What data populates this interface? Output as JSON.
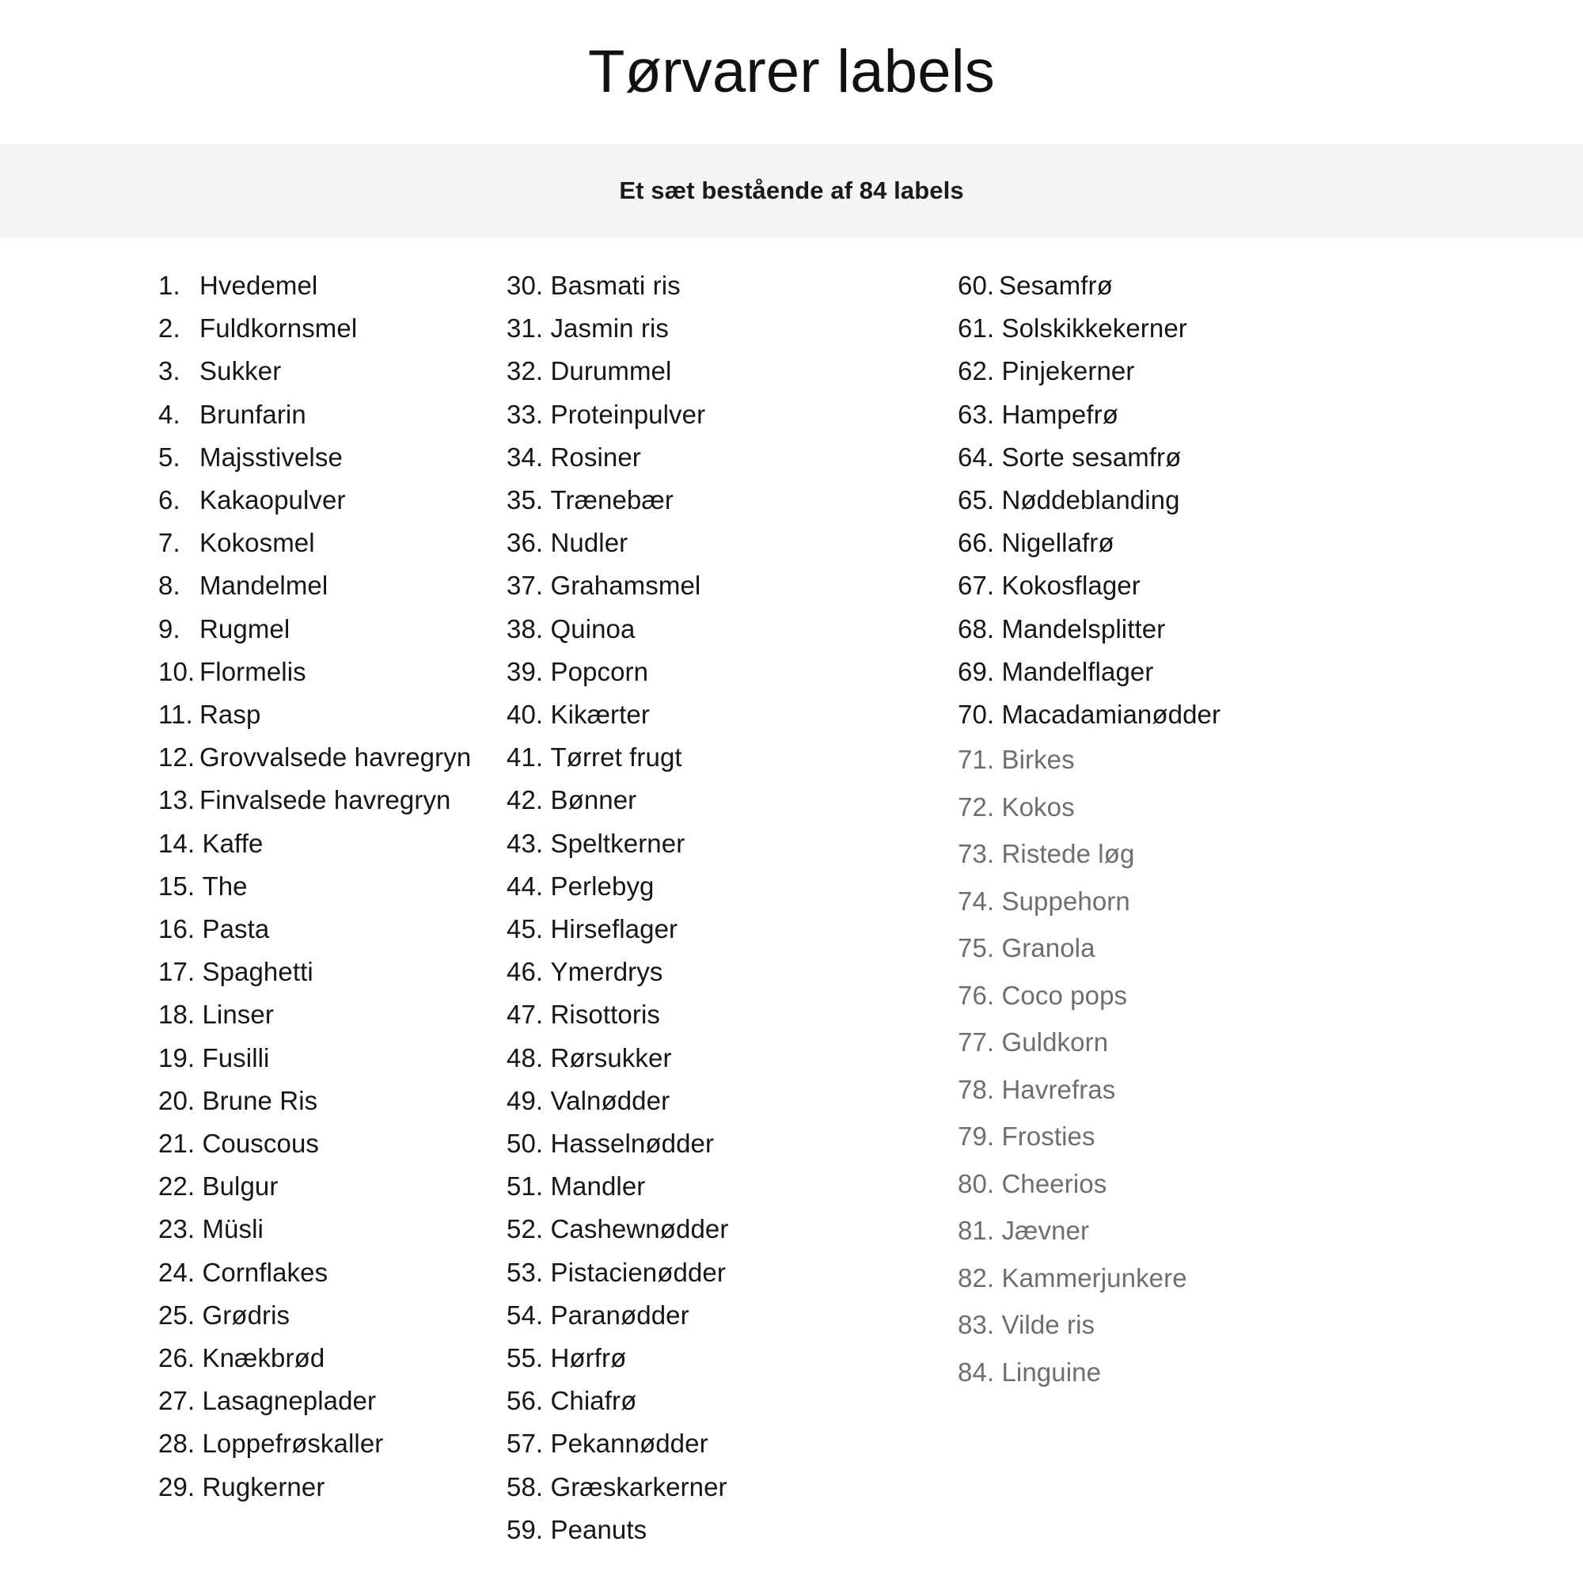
{
  "header": {
    "title": "Tørvarer labels",
    "subtitle": "Et sæt bestående af 84 labels",
    "subtitle_band_color": "#f5f5f5",
    "title_color": "#111111",
    "text_color": "#161616",
    "muted_text_color": "#6e6e6e",
    "background_color": "#ffffff"
  },
  "columns": [
    {
      "id": "column-1",
      "items": [
        {
          "num": "1.",
          "label": "Hvedemel",
          "spaced": true,
          "muted": false
        },
        {
          "num": "2.",
          "label": "Fuldkornsmel",
          "spaced": true,
          "muted": false
        },
        {
          "num": "3.",
          "label": "Sukker",
          "spaced": true,
          "muted": false
        },
        {
          "num": "4.",
          "label": "Brunfarin",
          "spaced": true,
          "muted": false
        },
        {
          "num": "5.",
          "label": "Majsstivelse",
          "spaced": true,
          "muted": false
        },
        {
          "num": "6.",
          "label": "Kakaopulver",
          "spaced": true,
          "muted": false
        },
        {
          "num": "7.",
          "label": "Kokosmel",
          "spaced": true,
          "muted": false
        },
        {
          "num": "8.",
          "label": "Mandelmel",
          "spaced": true,
          "muted": false
        },
        {
          "num": "9.",
          "label": "Rugmel",
          "spaced": true,
          "muted": false
        },
        {
          "num": "10.",
          "label": "Flormelis",
          "spaced": false,
          "muted": false
        },
        {
          "num": "11.",
          "label": "Rasp",
          "spaced": false,
          "muted": false
        },
        {
          "num": "12.",
          "label": "Grovvalsede havregryn",
          "spaced": false,
          "muted": false
        },
        {
          "num": "13.",
          "label": "Finvalsede havregryn",
          "spaced": false,
          "muted": false
        },
        {
          "num": "14.",
          "label": "Kaffe",
          "spaced": true,
          "muted": false
        },
        {
          "num": "15.",
          "label": "The",
          "spaced": true,
          "muted": false
        },
        {
          "num": "16.",
          "label": "Pasta",
          "spaced": true,
          "muted": false
        },
        {
          "num": "17.",
          "label": "Spaghetti",
          "spaced": true,
          "muted": false
        },
        {
          "num": "18.",
          "label": "Linser",
          "spaced": true,
          "muted": false
        },
        {
          "num": "19.",
          "label": "Fusilli",
          "spaced": true,
          "muted": false
        },
        {
          "num": "20.",
          "label": "Brune Ris",
          "spaced": true,
          "muted": false
        },
        {
          "num": "21.",
          "label": "Couscous",
          "spaced": true,
          "muted": false
        },
        {
          "num": "22.",
          "label": "Bulgur",
          "spaced": true,
          "muted": false
        },
        {
          "num": "23.",
          "label": "Müsli",
          "spaced": true,
          "muted": false
        },
        {
          "num": "24.",
          "label": "Cornflakes",
          "spaced": true,
          "muted": false
        },
        {
          "num": "25.",
          "label": "Grødris",
          "spaced": true,
          "muted": false
        },
        {
          "num": "26.",
          "label": "Knækbrød",
          "spaced": true,
          "muted": false
        },
        {
          "num": "27.",
          "label": "Lasagneplader",
          "spaced": true,
          "muted": false
        },
        {
          "num": "28.",
          "label": "Loppefrøskaller",
          "spaced": true,
          "muted": false
        },
        {
          "num": "29.",
          "label": "Rugkerner",
          "spaced": true,
          "muted": false
        }
      ]
    },
    {
      "id": "column-2",
      "items": [
        {
          "num": "30.",
          "label": "Basmati ris",
          "spaced": true,
          "muted": false
        },
        {
          "num": "31.",
          "label": "Jasmin ris",
          "spaced": true,
          "muted": false
        },
        {
          "num": "32.",
          "label": "Durummel",
          "spaced": true,
          "muted": false
        },
        {
          "num": "33.",
          "label": "Proteinpulver",
          "spaced": true,
          "muted": false
        },
        {
          "num": "34.",
          "label": "Rosiner",
          "spaced": true,
          "muted": false
        },
        {
          "num": "35.",
          "label": "Trænebær",
          "spaced": true,
          "muted": false
        },
        {
          "num": "36.",
          "label": "Nudler",
          "spaced": true,
          "muted": false
        },
        {
          "num": "37.",
          "label": "Grahamsmel",
          "spaced": true,
          "muted": false
        },
        {
          "num": "38.",
          "label": "Quinoa",
          "spaced": true,
          "muted": false
        },
        {
          "num": "39.",
          "label": "Popcorn",
          "spaced": true,
          "muted": false
        },
        {
          "num": "40.",
          "label": "Kikærter",
          "spaced": true,
          "muted": false
        },
        {
          "num": "41.",
          "label": "Tørret frugt",
          "spaced": true,
          "muted": false
        },
        {
          "num": "42.",
          "label": "Bønner",
          "spaced": true,
          "muted": false
        },
        {
          "num": "43.",
          "label": "Speltkerner",
          "spaced": true,
          "muted": false
        },
        {
          "num": "44.",
          "label": "Perlebyg",
          "spaced": true,
          "muted": false
        },
        {
          "num": "45.",
          "label": "Hirseflager",
          "spaced": true,
          "muted": false
        },
        {
          "num": "46.",
          "label": "Ymerdrys",
          "spaced": true,
          "muted": false
        },
        {
          "num": "47.",
          "label": "Risottoris",
          "spaced": true,
          "muted": false
        },
        {
          "num": "48.",
          "label": "Rørsukker",
          "spaced": true,
          "muted": false
        },
        {
          "num": "49.",
          "label": "Valnødder",
          "spaced": true,
          "muted": false
        },
        {
          "num": "50.",
          "label": "Hasselnødder",
          "spaced": true,
          "muted": false
        },
        {
          "num": "51.",
          "label": "Mandler",
          "spaced": true,
          "muted": false
        },
        {
          "num": "52.",
          "label": "Cashewnødder",
          "spaced": true,
          "muted": false
        },
        {
          "num": "53.",
          "label": "Pistacienødder",
          "spaced": true,
          "muted": false
        },
        {
          "num": "54.",
          "label": "Paranødder",
          "spaced": true,
          "muted": false
        },
        {
          "num": "55.",
          "label": "Hørfrø",
          "spaced": true,
          "muted": false
        },
        {
          "num": "56.",
          "label": "Chiafrø",
          "spaced": true,
          "muted": false
        },
        {
          "num": "57.",
          "label": "Pekannødder",
          "spaced": true,
          "muted": false
        },
        {
          "num": "58.",
          "label": "Græskarkerner",
          "spaced": true,
          "muted": false
        },
        {
          "num": "59.",
          "label": "Peanuts",
          "spaced": true,
          "muted": false
        }
      ]
    },
    {
      "id": "column-3",
      "items": [
        {
          "num": "60.",
          "label": "Sesamfrø",
          "spaced": false,
          "muted": false
        },
        {
          "num": "61.",
          "label": "Solskikkekerner",
          "spaced": true,
          "muted": false
        },
        {
          "num": "62.",
          "label": "Pinjekerner",
          "spaced": true,
          "muted": false
        },
        {
          "num": "63.",
          "label": "Hampefrø",
          "spaced": true,
          "muted": false
        },
        {
          "num": "64.",
          "label": "Sorte sesamfrø",
          "spaced": true,
          "muted": false
        },
        {
          "num": "65.",
          "label": "Nøddeblanding",
          "spaced": true,
          "muted": false
        },
        {
          "num": "66.",
          "label": "Nigellafrø",
          "spaced": true,
          "muted": false
        },
        {
          "num": "67.",
          "label": "Kokosflager",
          "spaced": true,
          "muted": false
        },
        {
          "num": "68.",
          "label": "Mandelsplitter",
          "spaced": true,
          "muted": false
        },
        {
          "num": "69.",
          "label": "Mandelflager",
          "spaced": true,
          "muted": false
        },
        {
          "num": "70.",
          "label": "Macadamianødder",
          "spaced": true,
          "muted": false
        },
        {
          "num": "71.",
          "label": "Birkes",
          "spaced": true,
          "muted": true
        },
        {
          "num": "72.",
          "label": "Kokos",
          "spaced": true,
          "muted": true
        },
        {
          "num": "73.",
          "label": "Ristede løg",
          "spaced": true,
          "muted": true
        },
        {
          "num": "74.",
          "label": "Suppehorn",
          "spaced": true,
          "muted": true
        },
        {
          "num": "75.",
          "label": "Granola",
          "spaced": true,
          "muted": true
        },
        {
          "num": "76.",
          "label": "Coco pops",
          "spaced": true,
          "muted": true
        },
        {
          "num": "77.",
          "label": "Guldkorn",
          "spaced": true,
          "muted": true
        },
        {
          "num": "78.",
          "label": "Havrefras",
          "spaced": true,
          "muted": true
        },
        {
          "num": "79.",
          "label": "Frosties",
          "spaced": true,
          "muted": true
        },
        {
          "num": "80.",
          "label": "Cheerios",
          "spaced": true,
          "muted": true
        },
        {
          "num": "81.",
          "label": "Jævner",
          "spaced": true,
          "muted": true
        },
        {
          "num": "82.",
          "label": "Kammerjunkere",
          "spaced": true,
          "muted": true
        },
        {
          "num": "83.",
          "label": "Vilde ris",
          "spaced": true,
          "muted": true
        },
        {
          "num": "84.",
          "label": "Linguine",
          "spaced": true,
          "muted": true
        }
      ]
    }
  ]
}
